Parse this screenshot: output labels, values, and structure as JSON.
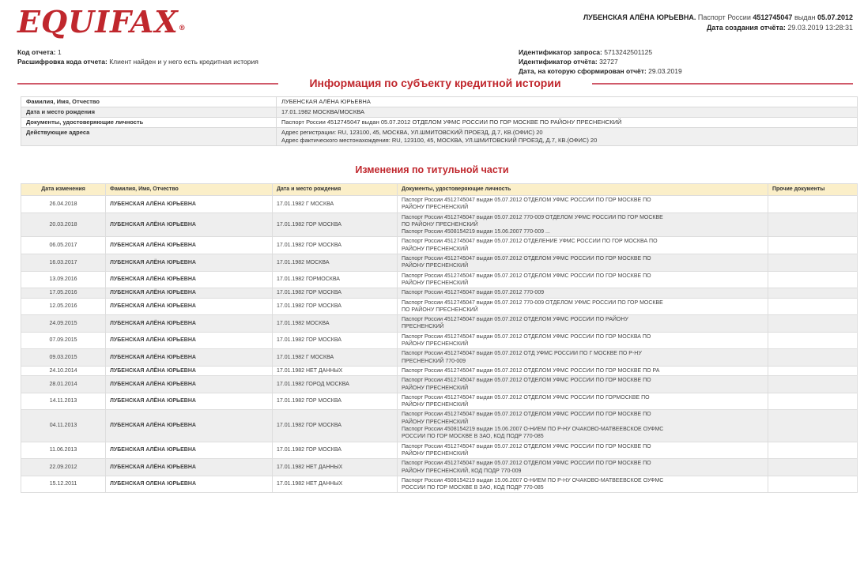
{
  "brand": {
    "logo_text": "EQUIFAX",
    "reg_mark": "®"
  },
  "header": {
    "subject_name": "ЛУБЕНСКАЯ АЛЁНА ЮРЬЕВНА.",
    "passport_label": "Паспорт России",
    "passport_number": "4512745047",
    "issued_label": "выдан",
    "issued_date": "05.07.2012",
    "created_label": "Дата создания отчёта:",
    "created_value": "29.03.2019 13:28:31"
  },
  "meta": {
    "report_code_label": "Код отчета:",
    "report_code_value": "1",
    "report_code_decoding_label": "Расшифровка кода отчета:",
    "report_code_decoding_value": "Клиент найден и у него есть кредитная история",
    "request_id_label": "Идентификатор запроса:",
    "request_id_value": "5713242501125",
    "report_id_label": "Идентификатор отчёта:",
    "report_id_value": "32727",
    "formed_date_label": "Дата, на которую сформирован отчёт:",
    "formed_date_value": "29.03.2019"
  },
  "section_title": "Информация по субъекту кредитной истории",
  "subject": {
    "rows": [
      {
        "key": "Фамилия, Имя, Отчество",
        "value": "ЛУБЕНСКАЯ АЛЁНА ЮРЬЕВНА"
      },
      {
        "key": "Дата и место рождения",
        "value": "17.01.1982  МОСКВА/МОСКВА"
      },
      {
        "key": "Документы, удостоверяющие личность",
        "value": "Паспорт России  4512745047  выдан  05.07.2012  ОТДЕЛОМ УФМС РОССИИ ПО ГОР МОСКВЕ ПО РАЙОНУ ПРЕСНЕНСКИЙ"
      }
    ],
    "address_key": "Действующие адреса",
    "address_reg": "Адрес регистрации: RU, 123100, 45, МОСКВА, УЛ.ШМИТОВСКИЙ ПРОЕЗД, Д.7, КВ.(ОФИС) 20",
    "address_fact": "Адрес фактического местонахождения: RU, 123100, 45, МОСКВА, УЛ.ШМИТОВСКИЙ ПРОЕЗД, Д.7, КВ.(ОФИС) 20"
  },
  "changes_title": "Изменения по титульной части",
  "changes": {
    "headers": [
      "Дата изменения",
      "Фамилия, Имя, Отчество",
      "Дата и место рождения",
      "Документы, удостоверяющие личность",
      "Прочие документы"
    ],
    "rows": [
      {
        "date": "26.04.2018",
        "name": "ЛУБЕНСКАЯ АЛЁНА ЮРЬЕВНА",
        "birth": "17.01.1982  Г МОСКВА",
        "docs": [
          "Паспорт России 4512745047 выдан 05.07.2012 ОТДЕЛОМ УФМС РОССИИ ПО ГОР МОСКВЕ ПО",
          "РАЙОНУ ПРЕСНЕНСКИЙ"
        ],
        "other": ""
      },
      {
        "date": "20.03.2018",
        "name": "ЛУБЕНСКАЯ АЛЁНА ЮРЬЕВНА",
        "birth": "17.01.1982  ГОР МОСКВА",
        "docs": [
          "Паспорт России 4512745047 выдан 05.07.2012 770-009 ОТДЕЛОМ УФМС РОССИИ ПО ГОР МОСКВЕ",
          "ПО РАЙОНУ ПРЕСНЕНСКИЙ",
          "Паспорт России 4508154219 выдан 15.06.2007 770-009 ..."
        ],
        "other": ""
      },
      {
        "date": "06.05.2017",
        "name": "ЛУБЕНСКАЯ АЛЁНА ЮРЬЕВНА",
        "birth": "17.01.1982  ГОР МОСКВА",
        "docs": [
          "Паспорт России 4512745047 выдан 05.07.2012 ОТДЕЛЕНИЕ УФМС РОССИИ ПО ГОР МОСКВА ПО",
          "РАЙОНУ ПРЕСНЕНСКИЙ"
        ],
        "other": ""
      },
      {
        "date": "16.03.2017",
        "name": "ЛУБЕНСКАЯ АЛЁНА ЮРЬЕВНА",
        "birth": "17.01.1982  МОСКВА",
        "docs": [
          "Паспорт России 4512745047 выдан 05.07.2012 ОТДЕЛОМ УФМС РОССИИ ПО ГОР МОСКВЕ ПО",
          "РАЙОНУ ПРЕСНЕНСКИЙ"
        ],
        "other": ""
      },
      {
        "date": "13.09.2016",
        "name": "ЛУБЕНСКАЯ АЛЁНА ЮРЬЕВНА",
        "birth": "17.01.1982  ГОРМОСКВА",
        "docs": [
          "Паспорт России 4512745047 выдан 05.07.2012 ОТДЕЛОМ УФМС РОССИИ ПО ГОР МОСКВЕ ПО",
          "РАЙОНУ ПРЕСНЕНСКИЙ"
        ],
        "other": ""
      },
      {
        "date": "17.05.2016",
        "name": "ЛУБЕНСКАЯ АЛЁНА ЮРЬЕВНА",
        "birth": "17.01.1982  ГОР МОСКВА",
        "docs": [
          "Паспорт России 4512745047 выдан 05.07.2012 770-009"
        ],
        "other": ""
      },
      {
        "date": "12.05.2016",
        "name": "ЛУБЕНСКАЯ АЛЁНА ЮРЬЕВНА",
        "birth": "17.01.1982  ГОР МОСКВА",
        "docs": [
          "Паспорт России 4512745047 выдан 05.07.2012 770-009 ОТДЕЛОМ УФМС РОССИИ ПО ГОР МОСКВЕ",
          "ПО РАЙОНУ ПРЕСНЕНСКИЙ"
        ],
        "other": ""
      },
      {
        "date": "24.09.2015",
        "name": "ЛУБЕНСКАЯ АЛЁНА ЮРЬЕВНА",
        "birth": "17.01.1982  МОСКВА",
        "docs": [
          "Паспорт России 4512745047 выдан 05.07.2012 ОТДЕЛОМ УФМС РОССИИ ПО РАЙОНУ",
          "ПРЕСНЕНСКИЙ"
        ],
        "other": ""
      },
      {
        "date": "07.09.2015",
        "name": "ЛУБЕНСКАЯ АЛЁНА ЮРЬЕВНА",
        "birth": "17.01.1982  ГОР МОСКВА",
        "docs": [
          "Паспорт России 4512745047 выдан 05.07.2012 ОТДЕЛОМ УФМС РОССИИ ПО ГОР МОСКВА ПО",
          "РАЙОНУ ПРЕСНЕНСКИЙ"
        ],
        "other": ""
      },
      {
        "date": "09.03.2015",
        "name": "ЛУБЕНСКАЯ АЛЁНА ЮРЬЕВНА",
        "birth": "17.01.1982  Г МОСКВА",
        "docs": [
          "Паспорт России 4512745047 выдан 05.07.2012 ОТД УФМС РОССИИ ПО Г МОСКВЕ ПО Р-НУ",
          "ПРЕСНЕНСКИЙ 770-009"
        ],
        "other": ""
      },
      {
        "date": "24.10.2014",
        "name": "ЛУБЕНСКАЯ АЛЁНА ЮРЬЕВНА",
        "birth": "17.01.1982  НЕТ ДАННЫХ",
        "docs": [
          "Паспорт России 4512745047 выдан 05.07.2012 ОТДЕЛОМ УФМС РОССИИ ПО ГОР МОСКВЕ ПО РА"
        ],
        "other": ""
      },
      {
        "date": "28.01.2014",
        "name": "ЛУБЕНСКАЯ АЛЁНА ЮРЬЕВНА",
        "birth": "17.01.1982  ГОРОД МОСКВА",
        "docs": [
          "Паспорт России 4512745047 выдан 05.07.2012 ОТДЕЛОМ УФМС РОССИИ ПО ГОР МОСКВЕ ПО",
          "РАЙОНУ ПРЕСНЕНСКИЙ"
        ],
        "other": ""
      },
      {
        "date": "14.11.2013",
        "name": "ЛУБЕНСКАЯ АЛЁНА ЮРЬЕВНА",
        "birth": "17.01.1982  ГОР МОСКВА",
        "docs": [
          "Паспорт России 4512745047 выдан 05.07.2012 ОТДЕЛОМ УФМС РОССИИ ПО ГОРМОСКВЕ ПО",
          "РАЙОНУ ПРЕСНЕНСКИЙ"
        ],
        "other": ""
      },
      {
        "date": "04.11.2013",
        "name": "ЛУБЕНСКАЯ АЛЁНА ЮРЬЕВНА",
        "birth": "17.01.1982  ГОР МОСКВА",
        "docs": [
          "Паспорт России 4512745047 выдан 05.07.2012 ОТДЕЛОМ УФМС РОССИИ ПО ГОР МОСКВЕ ПО",
          "РАЙОНУ ПРЕСНЕНСКИЙ",
          "Паспорт России 4508154219 выдан 15.06.2007 О-НИЕМ ПО Р-НУ ОЧАКОВО-МАТВЕЕВСКОЕ ОУФМС",
          "РОССИИ ПО ГОР МОСКВЕ В ЗАО, КОД ПОДР 770-085"
        ],
        "other": ""
      },
      {
        "date": "11.06.2013",
        "name": "ЛУБЕНСКАЯ АЛЁНА ЮРЬЕВНА",
        "birth": "17.01.1982  ГОР МОСКВА",
        "docs": [
          "Паспорт России 4512745047 выдан 05.07.2012 ОТДЕЛОМ УФМС РОССИИ ПО ГОР МОСКВЕ ПО",
          "РАЙОНУ ПРЕСНЕНСКИЙ"
        ],
        "other": ""
      },
      {
        "date": "22.09.2012",
        "name": "ЛУБЕНСКАЯ АЛЁНА ЮРЬЕВНА",
        "birth": "17.01.1982  НЕТ ДАННЫХ",
        "docs": [
          "Паспорт России 4512745047 выдан 05.07.2012 ОТДЕЛОМ УФМС РОССИИ ПО ГОР МОСКВЕ ПО",
          "РАЙОНУ ПРЕСНЕНСКИЙ, КОД ПОДР 770-009"
        ],
        "other": ""
      },
      {
        "date": "15.12.2011",
        "name": "ЛУБЕНСКАЯ ОЛЕНА ЮРЬЕВНА",
        "birth": "17.01.1982  НЕТ ДАННЫХ",
        "docs": [
          "Паспорт России 4508154219 выдан 15.06.2007 О-НИЕМ ПО Р-НУ ОЧАКОВО-МАТВЕЕВСКОЕ ОУФМС",
          "РОССИИ ПО ГОР МОСКВЕ В ЗАО, КОД ПОДР 770-085"
        ],
        "other": ""
      }
    ]
  },
  "colors": {
    "brand_red": "#c0272d",
    "header_bg": "#fbefc9",
    "rule": "#d05a6a"
  }
}
